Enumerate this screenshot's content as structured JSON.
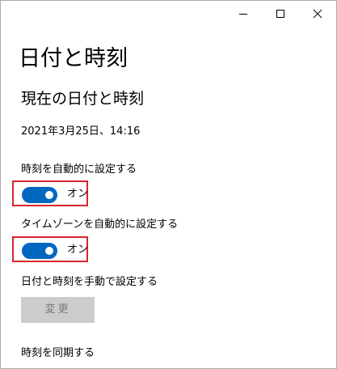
{
  "window": {
    "controls": {
      "minimize": "minimize-icon",
      "maximize": "maximize-icon",
      "close": "close-icon"
    }
  },
  "page": {
    "title": "日付と時刻"
  },
  "section": {
    "title": "現在の日付と時刻",
    "current_datetime": "2021年3月25日、14:16"
  },
  "settings": {
    "auto_time": {
      "label": "時刻を自動的に設定する",
      "state": "オン",
      "on": true
    },
    "auto_timezone": {
      "label": "タイムゾーンを自動的に設定する",
      "state": "オン",
      "on": true
    },
    "manual": {
      "label": "日付と時刻を手動で設定する",
      "button": "変更",
      "enabled": false
    },
    "sync": {
      "label": "時刻を同期する"
    }
  },
  "colors": {
    "accent": "#0067c0",
    "highlight_border": "#d9262c",
    "disabled_button": "#cccccc",
    "disabled_text": "#7a7a7a"
  }
}
